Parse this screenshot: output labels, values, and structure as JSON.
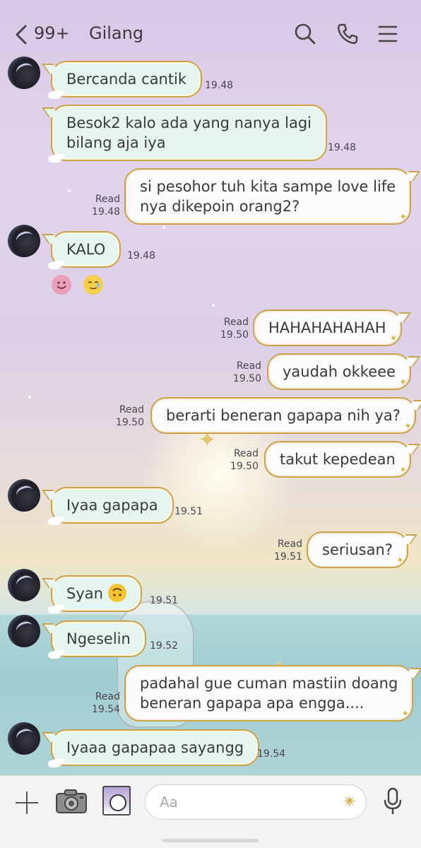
{
  "header": {
    "unread_count": "99+",
    "contact_name": "Gilang",
    "icons": [
      "chevron-left-icon",
      "search-icon",
      "phone-icon",
      "menu-icon"
    ]
  },
  "messages": [
    {
      "side": "in",
      "text": "Bercanda cantik",
      "time": "19.48"
    },
    {
      "side": "in",
      "line1": "Besok2 kalo ada yang nanya lagi",
      "line2": "bilang aja iya",
      "time": "19.48"
    },
    {
      "side": "out",
      "line1": "si pesohor tuh kita sampe love life",
      "line2": "nya dikepoin orang2?",
      "read": "Read",
      "time": "19.48"
    },
    {
      "side": "in",
      "text": "KALO",
      "time": "19.48"
    },
    {
      "side": "out",
      "text": "HAHAHAHAHAH",
      "read": "Read",
      "time": "19.50"
    },
    {
      "side": "out",
      "text": "yaudah okkeee",
      "read": "Read",
      "time": "19.50"
    },
    {
      "side": "out",
      "text": "berarti beneran gapapa nih ya?",
      "read": "Read",
      "time": "19.50"
    },
    {
      "side": "out",
      "text": "takut kepedean",
      "read": "Read",
      "time": "19.50"
    },
    {
      "side": "in",
      "text": "Iyaa gapapa",
      "time": "19.51"
    },
    {
      "side": "out",
      "text": "seriusan?",
      "read": "Read",
      "time": "19.51"
    },
    {
      "side": "in",
      "text": "Syan",
      "emoji": "upside-down-face-icon",
      "time": "19.51"
    },
    {
      "side": "in",
      "text": "Ngeselin",
      "time": "19.52"
    },
    {
      "side": "out",
      "line1": "padahal gue cuman mastiin doang",
      "line2": "beneran gapapa apa engga....",
      "read": "Read",
      "time": "19.54"
    },
    {
      "side": "in",
      "text": "Iyaaa gapapaa sayangg",
      "time": "19.54"
    }
  ],
  "reactions": [
    "smiling-face-icon",
    "smiling-face-with-tear-icon"
  ],
  "composer": {
    "placeholder": "Aa"
  },
  "colors": {
    "incoming_bubble": "#e6f5ef",
    "outgoing_bubble": "#fbfbfb",
    "bubble_border": "#c9a24a",
    "text": "#3a3a3a"
  }
}
